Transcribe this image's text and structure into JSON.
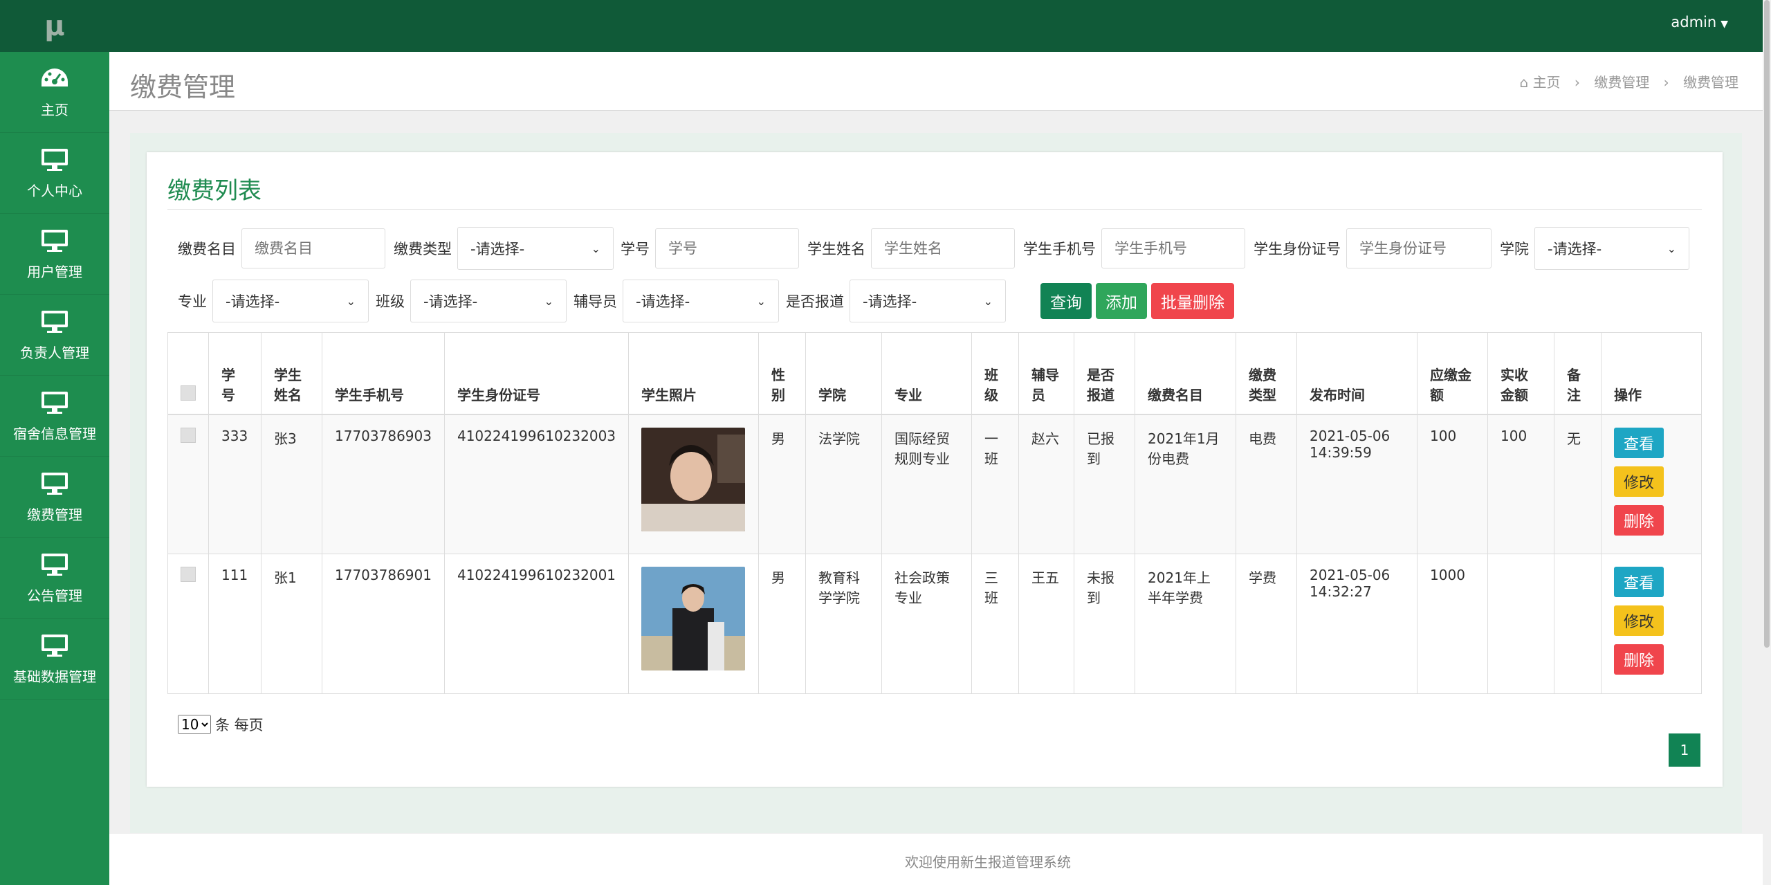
{
  "app": {
    "logo_text": "μ",
    "user": "admin"
  },
  "sidebar": {
    "items": [
      {
        "label": "主页",
        "icon": "dashboard-icon"
      },
      {
        "label": "个人中心",
        "icon": "monitor-icon"
      },
      {
        "label": "用户管理",
        "icon": "monitor-icon"
      },
      {
        "label": "负责人管理",
        "icon": "monitor-icon"
      },
      {
        "label": "宿舍信息管理",
        "icon": "monitor-icon"
      },
      {
        "label": "缴费管理",
        "icon": "monitor-icon"
      },
      {
        "label": "公告管理",
        "icon": "monitor-icon"
      },
      {
        "label": "基础数据管理",
        "icon": "monitor-icon"
      }
    ]
  },
  "header": {
    "title": "缴费管理",
    "breadcrumb": [
      "主页",
      "缴费管理",
      "缴费管理"
    ]
  },
  "panel": {
    "title": "缴费列表"
  },
  "filters": {
    "fee_name_label": "缴费名目",
    "fee_name_placeholder": "缴费名目",
    "fee_type_label": "缴费类型",
    "fee_type_value": "-请选择-",
    "student_no_label": "学号",
    "student_no_placeholder": "学号",
    "student_name_label": "学生姓名",
    "student_name_placeholder": "学生姓名",
    "phone_label": "学生手机号",
    "phone_placeholder": "学生手机号",
    "id_label": "学生身份证号",
    "id_placeholder": "学生身份证号",
    "college_label": "学院",
    "college_value": "-请选择-",
    "major_label": "专业",
    "major_value": "-请选择-",
    "class_label": "班级",
    "class_value": "-请选择-",
    "counselor_label": "辅导员",
    "counselor_value": "-请选择-",
    "reported_label": "是否报道",
    "reported_value": "-请选择-",
    "query_btn": "查询",
    "add_btn": "添加",
    "batch_delete_btn": "批量删除"
  },
  "table": {
    "headers": [
      "学号",
      "学生姓名",
      "学生手机号",
      "学生身份证号",
      "学生照片",
      "性别",
      "学院",
      "专业",
      "班级",
      "辅导员",
      "是否报道",
      "缴费名目",
      "缴费类型",
      "发布时间",
      "应缴金额",
      "实收金额",
      "备注",
      "操作"
    ],
    "rows": [
      {
        "student_no": "333",
        "name": "张3",
        "phone": "17703786903",
        "id_no": "410224199610232003",
        "gender": "男",
        "college": "法学院",
        "major": "国际经贸规则专业",
        "class": "一班",
        "counselor": "赵六",
        "reported": "已报到",
        "fee_name": "2021年1月份电费",
        "fee_type": "电费",
        "publish_time": "2021-05-06 14:39:59",
        "due": "100",
        "received": "100",
        "note": "无"
      },
      {
        "student_no": "111",
        "name": "张1",
        "phone": "17703786901",
        "id_no": "410224199610232001",
        "gender": "男",
        "college": "教育科学学院",
        "major": "社会政策专业",
        "class": "三班",
        "counselor": "王五",
        "reported": "未报到",
        "fee_name": "2021年上半年学费",
        "fee_type": "学费",
        "publish_time": "2021-05-06 14:32:27",
        "due": "1000",
        "received": "",
        "note": ""
      }
    ],
    "actions": {
      "view": "查看",
      "edit": "修改",
      "delete": "删除"
    }
  },
  "pagination": {
    "page_size": "10",
    "page_size_suffix": "条 每页",
    "current_page": "1"
  },
  "footer": {
    "text": "欢迎使用新生报道管理系统"
  },
  "colors": {
    "sidebar_bg": "#1e8d4f",
    "topbar_bg": "#105a38",
    "accent": "#118354",
    "danger": "#f0454c",
    "info": "#1ea6c4",
    "warning": "#f4c21c"
  }
}
